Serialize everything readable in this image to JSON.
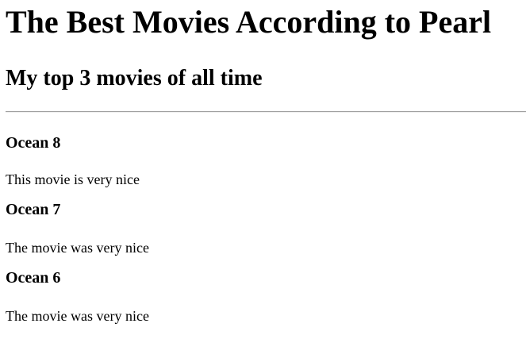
{
  "page": {
    "heading": "The Best Movies According to Pearl",
    "subheading": "My top 3 movies of all time"
  },
  "movies": [
    {
      "title": "Ocean 8",
      "review": "This movie is very nice"
    },
    {
      "title": "Ocean 7",
      "review": "The movie was very nice"
    },
    {
      "title": "Ocean 6",
      "review": "The movie was very nice"
    }
  ]
}
